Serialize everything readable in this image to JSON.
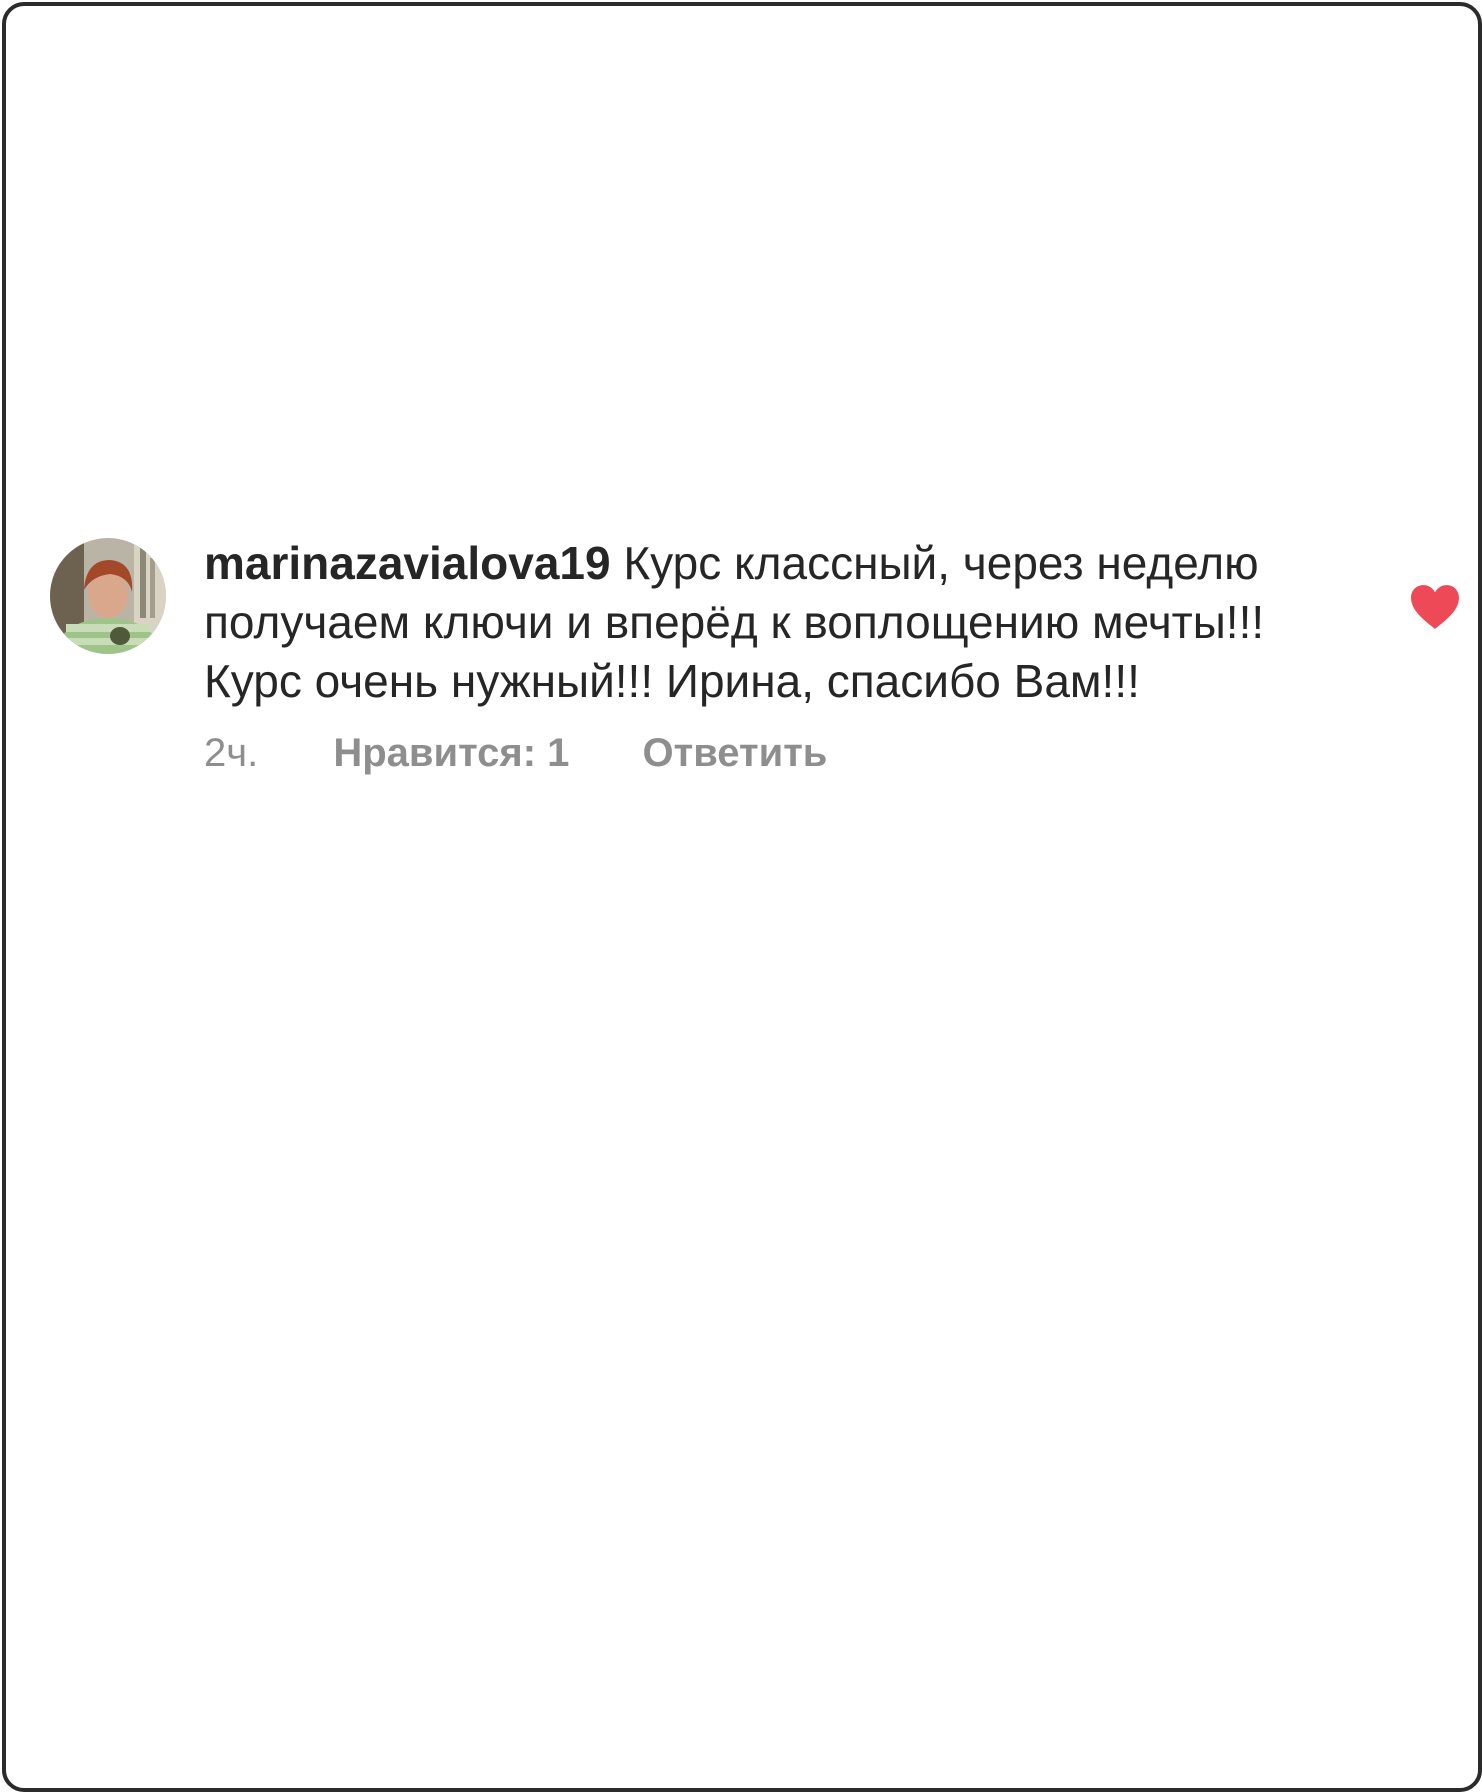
{
  "comment": {
    "username": "marinazavialova19",
    "text": "Курс классный, через неделю получаем ключи и вперёд к воплощению мечты!!! Курс очень нужный!!! Ирина, спасибо Вам!!!",
    "time": "2ч.",
    "likes_label": "Нравится: 1",
    "reply_label": "Ответить",
    "liked": true
  },
  "colors": {
    "heart": "#ed4956",
    "meta_text": "#8e8e8e",
    "body_text": "#262626"
  },
  "icons": {
    "like": "heart-icon",
    "avatar": "avatar"
  }
}
